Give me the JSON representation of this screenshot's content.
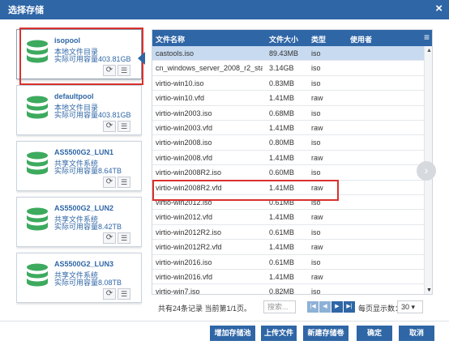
{
  "dialog": {
    "title": "选择存储",
    "close_icon": "×"
  },
  "pools": [
    {
      "name": "isopool",
      "type": "本地文件目录",
      "capacity": "实际可用容量403.81GB"
    },
    {
      "name": "defaultpool",
      "type": "本地文件目录",
      "capacity": "实际可用容量403.81GB"
    },
    {
      "name": "AS5500G2_LUN1",
      "type": "共享文件系统",
      "capacity": "实际可用容量8.64TB"
    },
    {
      "name": "AS5500G2_LUN2",
      "type": "共享文件系统",
      "capacity": "实际可用容量8.42TB"
    },
    {
      "name": "AS5500G2_LUN3",
      "type": "共享文件系统",
      "capacity": "实际可用容量8.08TB"
    }
  ],
  "pool_buttons": {
    "refresh_icon": "⟳",
    "list_icon": "☰"
  },
  "table": {
    "headers": {
      "name": "文件名称",
      "size": "文件大小",
      "type": "类型",
      "user": "使用者",
      "menu_icon": "≡"
    },
    "rows": [
      {
        "name": "castools.iso",
        "size": "89.43MB",
        "type": "iso"
      },
      {
        "name": "cn_windows_server_2008_r2_sta…",
        "size": "3.14GB",
        "type": "iso"
      },
      {
        "name": "virtio-win10.iso",
        "size": "0.83MB",
        "type": "iso"
      },
      {
        "name": "virtio-win10.vfd",
        "size": "1.41MB",
        "type": "raw"
      },
      {
        "name": "virtio-win2003.iso",
        "size": "0.68MB",
        "type": "iso"
      },
      {
        "name": "virtio-win2003.vfd",
        "size": "1.41MB",
        "type": "raw"
      },
      {
        "name": "virtio-win2008.iso",
        "size": "0.80MB",
        "type": "iso"
      },
      {
        "name": "virtio-win2008.vfd",
        "size": "1.41MB",
        "type": "raw"
      },
      {
        "name": "virtio-win2008R2.iso",
        "size": "0.60MB",
        "type": "iso"
      },
      {
        "name": "virtio-win2008R2.vfd",
        "size": "1.41MB",
        "type": "raw"
      },
      {
        "name": "virtio-win2012.iso",
        "size": "0.61MB",
        "type": "iso"
      },
      {
        "name": "virtio-win2012.vfd",
        "size": "1.41MB",
        "type": "raw"
      },
      {
        "name": "virtio-win2012R2.iso",
        "size": "0.61MB",
        "type": "iso"
      },
      {
        "name": "virtio-win2012R2.vfd",
        "size": "1.41MB",
        "type": "raw"
      },
      {
        "name": "virtio-win2016.iso",
        "size": "0.61MB",
        "type": "iso"
      },
      {
        "name": "virtio-win2016.vfd",
        "size": "1.41MB",
        "type": "raw"
      },
      {
        "name": "virtio-win7.iso",
        "size": "0.82MB",
        "type": "iso"
      }
    ],
    "scroll_up": "▲",
    "scroll_down": "▼"
  },
  "next_icon": "›",
  "pager": {
    "summary": "共有24条记录 当前第1/1页。",
    "search_placeholder": "搜索...",
    "first": "|◀",
    "prev": "◀",
    "next": "▶",
    "last": "▶|",
    "per_page_label": "每页显示数：",
    "per_page_value": "30 ▾"
  },
  "footer": {
    "add_pool": "增加存储池",
    "upload": "上传文件",
    "new_volume": "新建存储卷",
    "ok": "确定",
    "cancel": "取消"
  },
  "colors": {
    "accent": "#2f66a6",
    "highlight": "#d9302c",
    "db_green": "#3daa5e"
  }
}
